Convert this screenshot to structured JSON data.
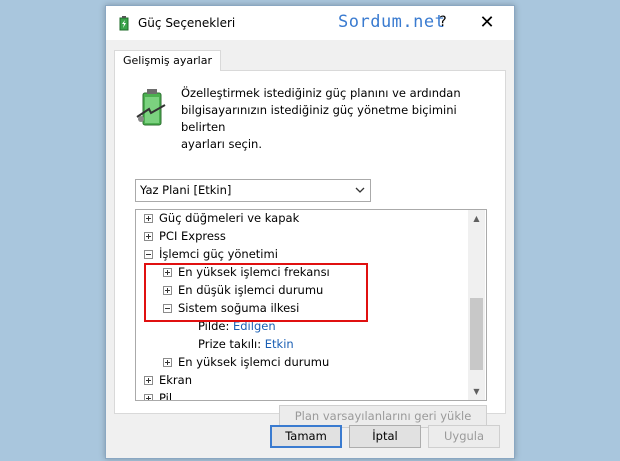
{
  "window": {
    "title": "Güç Seçenekleri",
    "watermark": "Sordum.net",
    "help_label": "?",
    "close_label": "✕"
  },
  "tab": {
    "label": "Gelişmiş ayarlar"
  },
  "description": "Özelleştirmek istediğiniz güç planını ve ardından\nbilgisayarınızın istediğiniz güç yönetme biçimini belirten\nayarları seçin.",
  "plan_select": {
    "value": "Yaz Plani [Etkin]"
  },
  "tree": {
    "items": [
      {
        "label": "Güç düğmeleri ve kapak",
        "expander": "plus"
      },
      {
        "label": "PCI Express",
        "expander": "plus"
      },
      {
        "label": "İşlemci güç yönetimi",
        "expander": "minus"
      },
      {
        "label": "En yüksek işlemci frekansı",
        "expander": "plus"
      },
      {
        "label": "En düşük işlemci durumu",
        "expander": "plus"
      },
      {
        "label": "Sistem soğuma ilkesi",
        "expander": "minus"
      },
      {
        "label": "Pilde:",
        "value": "Edilgen"
      },
      {
        "label": "Prize takılı:",
        "value": "Etkin"
      },
      {
        "label": "En yüksek işlemci durumu",
        "expander": "plus"
      },
      {
        "label": "Ekran",
        "expander": "plus"
      },
      {
        "label": "Pil",
        "expander": "plus"
      }
    ]
  },
  "restore_button": {
    "label": "Plan varsayılanlarını geri yükle"
  },
  "buttons": {
    "ok": "Tamam",
    "cancel": "İptal",
    "apply": "Uygula"
  },
  "colors": {
    "highlight": "#e01010",
    "link": "#1a5fb4",
    "watermark": "#3a7bd0"
  }
}
